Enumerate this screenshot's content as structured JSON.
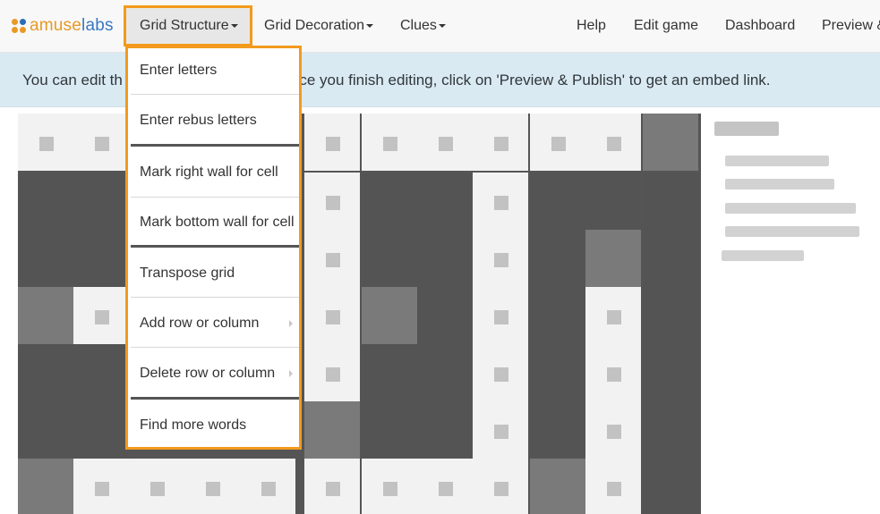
{
  "logo": {
    "prefix": "amuse",
    "suffix": "labs"
  },
  "nav": {
    "grid_structure": "Grid Structure",
    "grid_decoration": "Grid Decoration",
    "clues": "Clues",
    "help": "Help",
    "edit_game": "Edit game",
    "dashboard": "Dashboard",
    "preview": "Preview &"
  },
  "banner": {
    "text_left": "You can edit th",
    "text_right": "nce you finish editing, click on 'Preview & Publish' to get an embed link."
  },
  "dropdown": {
    "items": [
      "Enter letters",
      "Enter rebus letters",
      "Mark right wall for cell",
      "Mark bottom wall for cell",
      "Transpose grid",
      "Add row or column",
      "Delete row or column",
      "Find more words"
    ]
  },
  "colors": {
    "accent": "#f39a1d",
    "banner": "#d9eaf3",
    "brand_orange": "#e89a24",
    "brand_blue": "#3a78c2"
  }
}
